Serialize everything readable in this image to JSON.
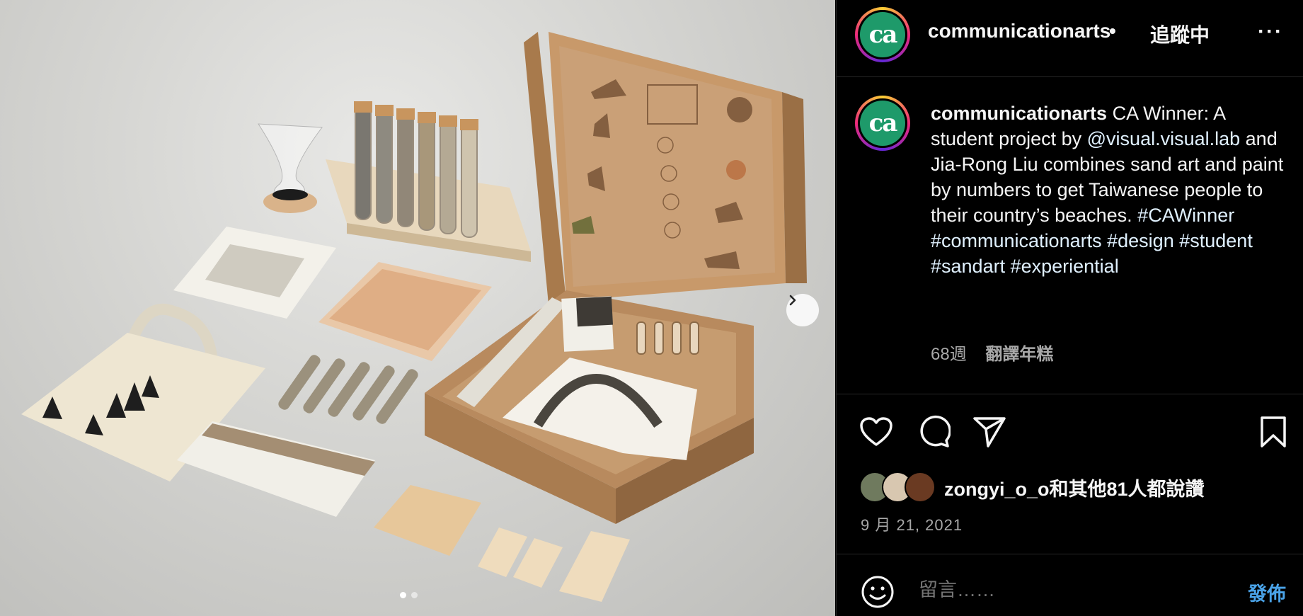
{
  "media": {
    "alt_icon": "chevron-right-icon",
    "carousel": {
      "current": 1,
      "total": 2
    }
  },
  "header": {
    "username": "communicationarts",
    "separator": "•",
    "follow_label": "追蹤中",
    "more_label": "···",
    "avatar_text": "ca"
  },
  "caption": {
    "username": "communicationarts",
    "text_1": " CA Winner: A student project by ",
    "mention": "@visual.visual.lab",
    "text_2": " and Jia-Rong Liu combines sand art and paint by numbers to get Taiwanese people to their country’s beaches. ",
    "hashtags": [
      "#CAWinner",
      "#communicationarts",
      "#design",
      "#student",
      "#sandart",
      "#experiential"
    ]
  },
  "meta": {
    "age": "68週",
    "translate_label": "翻譯年糕"
  },
  "actions": {
    "like": "heart-icon",
    "comment": "comment-icon",
    "share": "send-icon",
    "save": "bookmark-icon"
  },
  "likes": {
    "text": "zongyi_o_o和其他81人都說讚"
  },
  "date": "9 月 21, 2021",
  "comment": {
    "placeholder": "留言……",
    "post_label": "發佈"
  },
  "colors": {
    "background": "#000000",
    "link": "#e0f1ff",
    "post_button": "#4aa3e8",
    "muted": "#a8a8a8",
    "brand_green": "#1e9a6a"
  }
}
